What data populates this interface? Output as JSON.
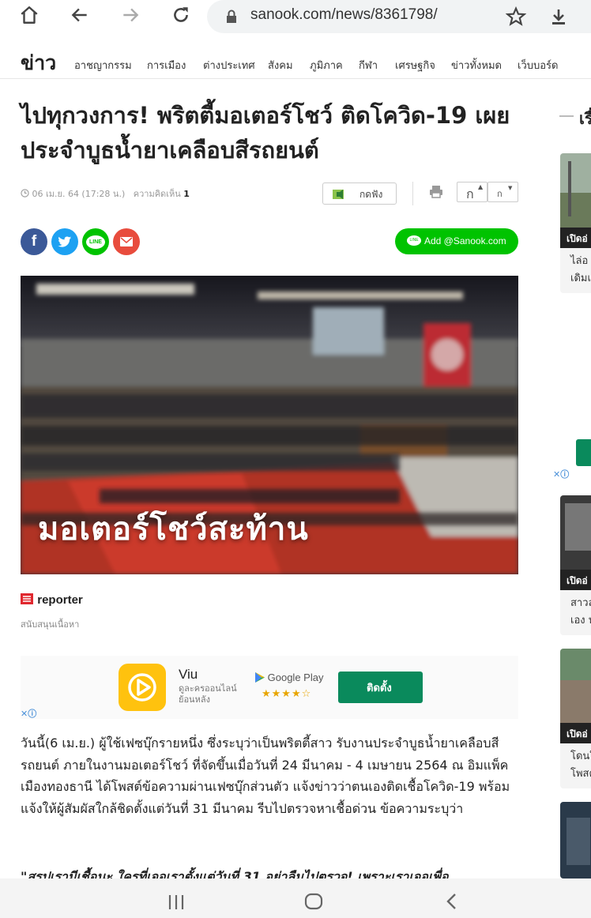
{
  "browser": {
    "url": "sanook.com/news/8361798/"
  },
  "site": {
    "logo": "ข่าว",
    "nav_items": [
      "อาชญากรรม",
      "การเมือง",
      "ต่างประเทศ",
      "สังคม",
      "ภูมิภาค",
      "กีฬา",
      "เศรษฐกิจ",
      "ข่าวทั้งหมด",
      "เว็บบอร์ด"
    ]
  },
  "article": {
    "headline_line1": "ไปทุกวงการ! พริตตี้มอเตอร์โชว์ ติดโควิด-19 เผย",
    "headline_line2": "ประจำบูธน้ำยาเคลือบสีรถยนต์",
    "date": "06 เม.ย. 64 (17:28 น.)",
    "comments_label": "ความคิดเห็น",
    "comments_count": "1",
    "listen_label": "กดฟัง",
    "font_increase": "ก",
    "font_decrease": "ก",
    "add_line_label": "Add @Sanook.com",
    "hero_caption": "มอเตอร์โชว์สะท้าน",
    "reporter": "reporter",
    "reporter_sub": "สนับสนุนเนื้อหา",
    "paragraph1": "วันนี้(6 เม.ย.) ผู้ใช้เฟซบุ๊กรายหนึ่ง ซึ่งระบุว่าเป็นพริตตี้สาว รับงานประจำบูธน้ำยาเคลือบสีรถยนต์ ภายในงานมอเตอร์โชว์ ที่จัดขึ้นเมื่อวันที่ 24 มีนาคม - 4 เมษายน 2564 ณ อิมแพ็ค เมืองทองธานี ได้โพสต์ข้อความผ่านเฟซบุ๊กส่วนตัว แจ้งข่าวว่าตนเองติดเชื้อโควิด-19 พร้อมแจ้งให้ผู้สัมผัสใกล้ชิดตั้งแต่วันที่ 31 มีนาคม รีบไปตรวจหาเชื้อด่วน ข้อความระบุว่า",
    "quote_partial": "\"สรุปเรามีเชื้อนะ ใครที่เจอเราตั้งแต่วันที่ 31 อย่าลืมไปตรวจ! เพราะเราเจอเพื่อ"
  },
  "ad": {
    "app_name": "Viu",
    "app_sub": "ดูละครออนไลน์ ย้อนหลัง",
    "store": "Google Play",
    "stars": "★★★★☆",
    "install_label": "ติดตั้ง"
  },
  "sidebar": {
    "heading": "เรื่",
    "card_tag": "เปิดอ่",
    "card1_line1": "ไล่อ",
    "card1_line2": "เดิมเ",
    "card2_line1": "สาวล",
    "card2_line2": "เอง ห",
    "card3_line1": "โดนใ",
    "card3_line2": "โพสต"
  },
  "colors": {
    "facebook": "#3b5998",
    "twitter": "#1da1f2",
    "line": "#00c300",
    "email": "#e84c3d",
    "reporter_red": "#e0282f"
  }
}
